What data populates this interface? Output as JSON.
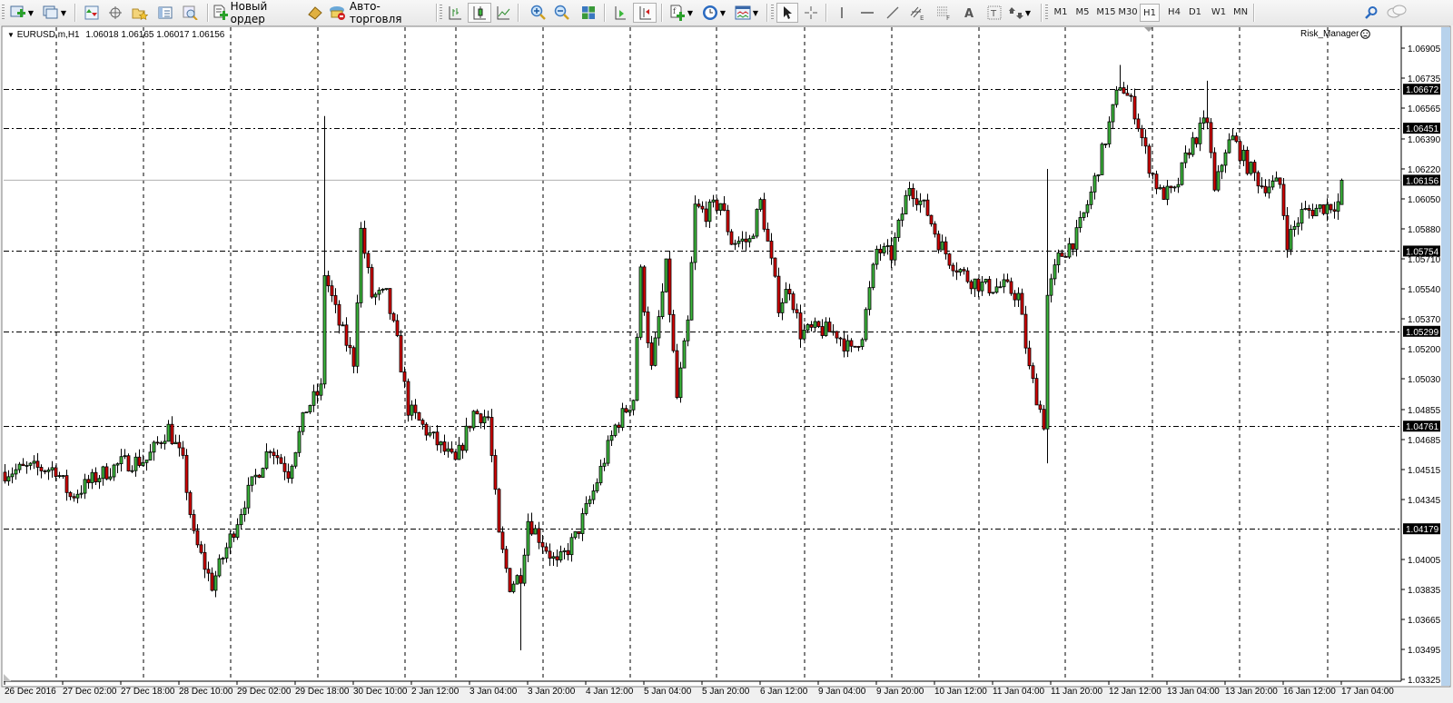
{
  "toolbar": {
    "new_order_label": "Новый ордер",
    "autotrading_label": "Авто-торговля",
    "timeframes": [
      "M1",
      "M5",
      "M15",
      "M30",
      "H1",
      "H4",
      "D1",
      "W1",
      "MN"
    ],
    "active_timeframe": "H1"
  },
  "chart_header": {
    "symbol_period": "EURUSD,m,H1",
    "ohlc": "1.06018 1.06165 1.06017 1.06156",
    "indicator": "Risk_Manager"
  },
  "colors": {
    "bull": "#3cb83c",
    "bear": "#d40000",
    "wick": "#000000",
    "level_line": "#000000",
    "current_price_line": "#b0b0b0",
    "scrollbar": "#b7d2ec"
  },
  "price_axis": {
    "labels": [
      "1.06905",
      "1.06735",
      "1.06565",
      "1.06390",
      "1.06220",
      "1.06050",
      "1.05880",
      "1.05710",
      "1.05540",
      "1.05370",
      "1.05200",
      "1.05030",
      "1.04855",
      "1.04685",
      "1.04515",
      "1.04345",
      "1.04005",
      "1.03835",
      "1.03665",
      "1.03495",
      "1.03325"
    ],
    "levels": [
      "1.06672",
      "1.06451",
      "1.05754",
      "1.05299",
      "1.04761",
      "1.04179"
    ],
    "current_price": "1.06156"
  },
  "time_axis": {
    "labels": [
      "26 Dec 2016",
      "27 Dec 02:00",
      "27 Dec 18:00",
      "28 Dec 10:00",
      "29 Dec 02:00",
      "29 Dec 18:00",
      "30 Dec 10:00",
      "2 Jan 12:00",
      "3 Jan 04:00",
      "3 Jan 20:00",
      "4 Jan 12:00",
      "5 Jan 04:00",
      "5 Jan 20:00",
      "6 Jan 12:00",
      "9 Jan 04:00",
      "9 Jan 20:00",
      "10 Jan 12:00",
      "11 Jan 04:00",
      "11 Jan 20:00",
      "12 Jan 12:00",
      "13 Jan 04:00",
      "13 Jan 20:00",
      "16 Jan 12:00",
      "17 Jan 04:00"
    ]
  },
  "chart_data": {
    "type": "candlestick",
    "symbol": "EURUSD",
    "timeframe": "H1",
    "ylim": [
      1.03325,
      1.06905
    ],
    "last_bar": {
      "open": 1.06018,
      "high": 1.06165,
      "low": 1.06017,
      "close": 1.06156
    },
    "close_path_anchors": [
      [
        0,
        1.045
      ],
      [
        6,
        1.0452
      ],
      [
        14,
        1.0452
      ],
      [
        18,
        1.0436
      ],
      [
        25,
        1.0447
      ],
      [
        32,
        1.0455
      ],
      [
        39,
        1.0457
      ],
      [
        45,
        1.0475
      ],
      [
        49,
        1.0455
      ],
      [
        52,
        1.0413
      ],
      [
        57,
        1.0386
      ],
      [
        61,
        1.0407
      ],
      [
        66,
        1.0434
      ],
      [
        73,
        1.0465
      ],
      [
        78,
        1.045
      ],
      [
        83,
        1.0486
      ],
      [
        87,
        1.0497
      ],
      [
        88,
        1.0563
      ],
      [
        92,
        1.0534
      ],
      [
        96,
        1.0513
      ],
      [
        98,
        1.0587
      ],
      [
        101,
        1.055
      ],
      [
        105,
        1.055
      ],
      [
        108,
        1.0523
      ],
      [
        111,
        1.0486
      ],
      [
        117,
        1.0471
      ],
      [
        124,
        1.0455
      ],
      [
        129,
        1.0484
      ],
      [
        133,
        1.0481
      ],
      [
        136,
        1.0413
      ],
      [
        139,
        1.0386
      ],
      [
        142,
        1.0392
      ],
      [
        144,
        1.0423
      ],
      [
        149,
        1.0407
      ],
      [
        152,
        1.0397
      ],
      [
        157,
        1.0413
      ],
      [
        162,
        1.0439
      ],
      [
        168,
        1.0476
      ],
      [
        173,
        1.0492
      ],
      [
        175,
        1.0563
      ],
      [
        178,
        1.0508
      ],
      [
        182,
        1.0566
      ],
      [
        185,
        1.0492
      ],
      [
        188,
        1.0534
      ],
      [
        190,
        1.06
      ],
      [
        193,
        1.0597
      ],
      [
        197,
        1.0603
      ],
      [
        200,
        1.0581
      ],
      [
        205,
        1.0581
      ],
      [
        208,
        1.0603
      ],
      [
        213,
        1.0545
      ],
      [
        216,
        1.0555
      ],
      [
        219,
        1.0529
      ],
      [
        224,
        1.0531
      ],
      [
        229,
        1.0529
      ],
      [
        233,
        1.0518
      ],
      [
        236,
        1.0529
      ],
      [
        240,
        1.0576
      ],
      [
        244,
        1.0573
      ],
      [
        249,
        1.0613
      ],
      [
        254,
        1.0597
      ],
      [
        257,
        1.0581
      ],
      [
        260,
        1.0571
      ],
      [
        265,
        1.056
      ],
      [
        270,
        1.0555
      ],
      [
        275,
        1.0555
      ],
      [
        279,
        1.055
      ],
      [
        282,
        1.0508
      ],
      [
        286,
        1.0478
      ],
      [
        287,
        1.055
      ],
      [
        290,
        1.0571
      ],
      [
        295,
        1.0584
      ],
      [
        299,
        1.0608
      ],
      [
        303,
        1.0639
      ],
      [
        307,
        1.0671
      ],
      [
        311,
        1.0655
      ],
      [
        315,
        1.0624
      ],
      [
        318,
        1.0608
      ],
      [
        322,
        1.0608
      ],
      [
        326,
        1.0634
      ],
      [
        331,
        1.065
      ],
      [
        333,
        1.0608
      ],
      [
        336,
        1.0634
      ],
      [
        338,
        1.0639
      ],
      [
        342,
        1.0624
      ],
      [
        346,
        1.0613
      ],
      [
        351,
        1.0613
      ],
      [
        353,
        1.0581
      ],
      [
        357,
        1.0597
      ],
      [
        362,
        1.06
      ],
      [
        367,
        1.0603
      ],
      [
        368,
        1.06156
      ]
    ],
    "spikes": [
      [
        88,
        1.0652,
        null
      ],
      [
        142,
        null,
        1.0349
      ],
      [
        287,
        1.0622,
        1.0455
      ],
      [
        307,
        1.0681,
        null
      ],
      [
        331,
        1.0672,
        null
      ]
    ]
  }
}
